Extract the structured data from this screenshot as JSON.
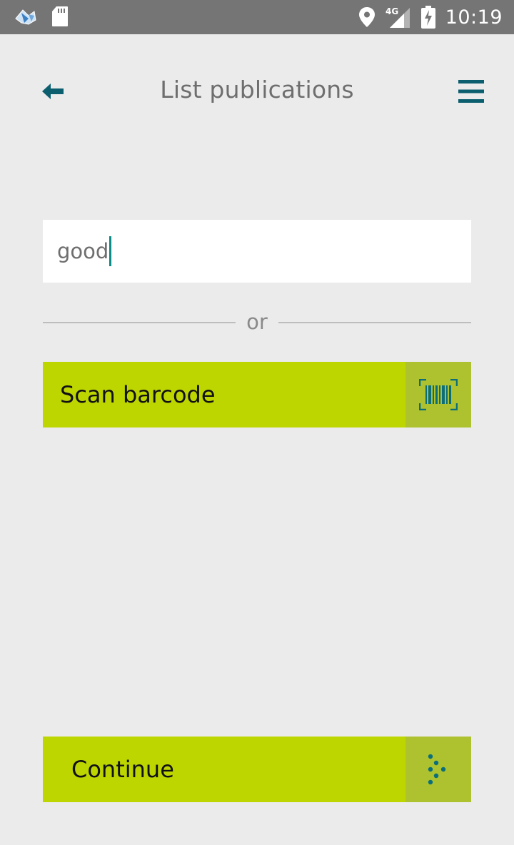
{
  "status_bar": {
    "time": "10:19",
    "network": "4G",
    "icons": [
      "app-notification-icon",
      "sd-card-icon",
      "location-icon",
      "signal-icon",
      "battery-charging-icon"
    ]
  },
  "header": {
    "title": "List publications",
    "icons": [
      "back-arrow-icon",
      "hamburger-menu-icon"
    ]
  },
  "search": {
    "value": "good"
  },
  "divider": {
    "text": "or"
  },
  "scan_button": {
    "label": "Scan barcode",
    "icon": "barcode-scan-icon"
  },
  "continue_button": {
    "label": "Continue",
    "icon": "dotted-arrow-icon"
  },
  "colors": {
    "accent": "#bed600",
    "accent_dark": "#adc22e",
    "teal": "#0b6e7a",
    "background": "#ebebeb",
    "status_bar": "#757575"
  }
}
